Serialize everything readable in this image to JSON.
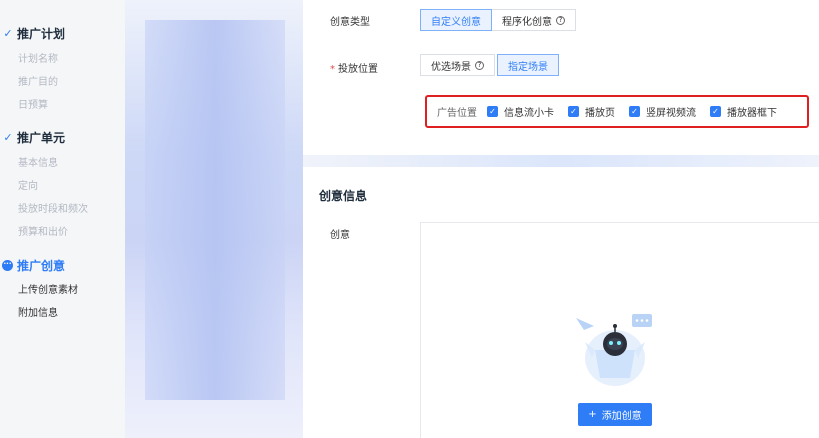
{
  "sidebar": {
    "sections": [
      {
        "title": "推广计划",
        "items": [
          "计划名称",
          "推广目的",
          "日预算"
        ]
      },
      {
        "title": "推广单元",
        "items": [
          "基本信息",
          "定向",
          "投放时段和频次",
          "预算和出价"
        ]
      },
      {
        "title": "推广创意",
        "items": [
          "上传创意素材",
          "附加信息"
        ]
      }
    ]
  },
  "form": {
    "creative_type_label": "创意类型",
    "creative_type_options": [
      "自定义创意",
      "程序化创意"
    ],
    "placement_label": "投放位置",
    "placement_options": [
      "优选场景",
      "指定场景"
    ],
    "ad_position": {
      "label": "广告位置",
      "options": [
        "信息流小卡",
        "播放页",
        "竖屏视频流",
        "播放器框下"
      ]
    }
  },
  "creative_info": {
    "title": "创意信息",
    "field_label": "创意",
    "add_button": "添加创意"
  },
  "colors": {
    "accent": "#2f7df6",
    "highlight_border": "#e02020"
  }
}
